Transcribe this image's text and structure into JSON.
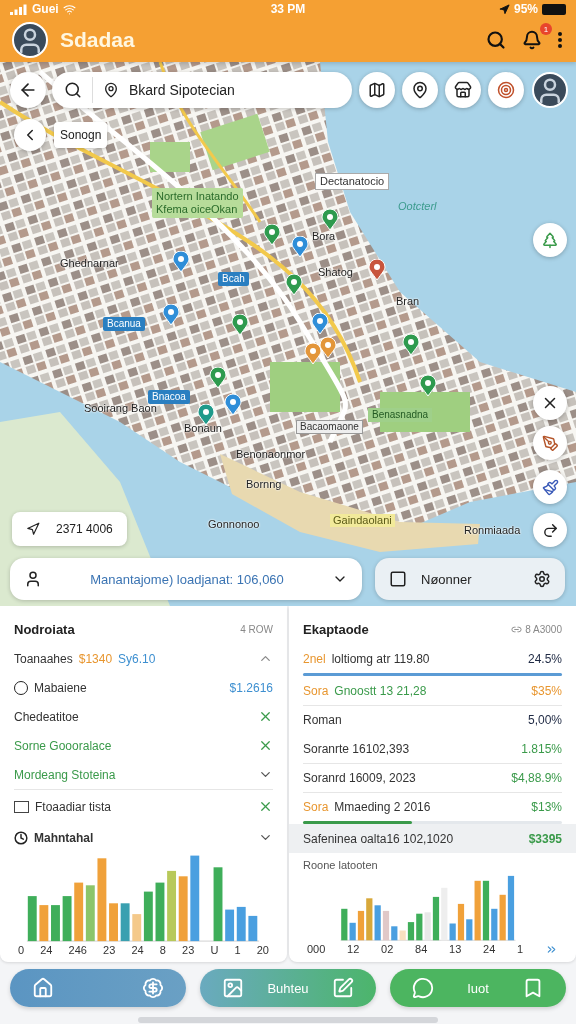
{
  "status_bar": {
    "carrier": "Guei",
    "time": "33 PM",
    "battery": "95%"
  },
  "app_bar": {
    "title": "Sdadaa",
    "notification_badge": "1"
  },
  "search": {
    "value": "Bkard Sipotecian"
  },
  "map": {
    "chip": "Sonogn",
    "date_chip": "2371 4006",
    "labels": [
      {
        "kind": "district",
        "lines": [
          "Nortern Inatando",
          "Kfema oiceOkan"
        ]
      },
      {
        "kind": "callout",
        "lines": [
          "Dectanatocio"
        ]
      },
      {
        "kind": "water",
        "lines": [
          "Ootcterl"
        ]
      },
      {
        "kind": "plain",
        "lines": [
          "Bora"
        ]
      },
      {
        "kind": "plain",
        "lines": [
          "Ghednarnar"
        ]
      },
      {
        "kind": "plain",
        "lines": [
          "Shatog"
        ]
      },
      {
        "kind": "plain",
        "lines": [
          "Bran"
        ]
      },
      {
        "kind": "plain",
        "lines": [
          "Sooirang Baon"
        ]
      },
      {
        "kind": "plain",
        "lines": [
          "Bonaun"
        ]
      },
      {
        "kind": "plain",
        "lines": [
          "Benonaonmor"
        ]
      },
      {
        "kind": "plain",
        "lines": [
          "Bornng"
        ]
      },
      {
        "kind": "plain",
        "lines": [
          "Gonnonoo"
        ]
      },
      {
        "kind": "highlight",
        "lines": [
          "Gaindaolani"
        ]
      },
      {
        "kind": "plain",
        "lines": [
          "Ronmiaada"
        ]
      },
      {
        "kind": "tag",
        "lines": [
          "Bcah"
        ]
      },
      {
        "kind": "tag",
        "lines": [
          "Bcanua"
        ]
      },
      {
        "kind": "tag",
        "lines": [
          "Bnacoa"
        ]
      },
      {
        "kind": "park",
        "lines": [
          "Benasnadna"
        ]
      },
      {
        "kind": "road",
        "lines": [
          "Bacaomaone"
        ]
      }
    ],
    "pins": [
      {
        "color": "#2f8ed8"
      },
      {
        "color": "#2e9a4e"
      },
      {
        "color": "#2f8ed8"
      },
      {
        "color": "#2e9a4e"
      },
      {
        "color": "#2e9a4e"
      },
      {
        "color": "#c8553d"
      },
      {
        "color": "#2f8ed8"
      },
      {
        "color": "#2f8ed8"
      },
      {
        "color": "#e3963a"
      },
      {
        "color": "#e3963a"
      },
      {
        "color": "#2e9a4e"
      },
      {
        "color": "#2e9a4e"
      },
      {
        "color": "#2e9a4e"
      },
      {
        "color": "#2f8ed8"
      },
      {
        "color": "#1f9a8a"
      },
      {
        "color": "#2e9a4e"
      }
    ]
  },
  "route_field": {
    "value": "Manantajome) loadjanat: 106,060"
  },
  "mode_card": {
    "label": "Nøonner"
  },
  "left_panel": {
    "title": "Nodroiata",
    "caption": "4 ROW",
    "rows": [
      {
        "kind": "amounts",
        "label": "Toanaahes",
        "amount_1": "$1340",
        "amount_2": "Sy6.10",
        "expanded": true
      },
      {
        "kind": "radio",
        "label": "Mabaiene",
        "value": "$1.2616",
        "selected": false
      },
      {
        "kind": "removable",
        "label": "Chedeatitoe",
        "accented": false
      },
      {
        "kind": "removable",
        "label": "Sorne Goooralace",
        "accented": true
      },
      {
        "kind": "expandable",
        "label": "Mordeang Stoteina",
        "accented": true,
        "expanded": false
      },
      {
        "kind": "checkbox",
        "label": "Ftoaadiar tista",
        "checked": false
      },
      {
        "kind": "heading",
        "label": "Mahntahal",
        "expanded": false
      }
    ],
    "chart_labels": [
      "0",
      "24",
      "246",
      "23",
      "24",
      "8",
      "23",
      "U",
      "1",
      "20"
    ]
  },
  "right_panel": {
    "title": "Ekaptaode",
    "caption": "8 A3000",
    "rows": [
      {
        "prefix": "2nel",
        "label": "loltiomg atr 119.80",
        "label_accented": false,
        "value": "24.5%",
        "color": "#1f2a44",
        "level": 1,
        "selected": false
      },
      {
        "prefix": "Sora",
        "label": "Gnoostt 13 21,28",
        "label_accented": true,
        "value": "$35%",
        "color": "#e8962f",
        "selected": false
      },
      {
        "label": "Roman",
        "label_accented": false,
        "value": "5,00%",
        "color": "#1f2a44",
        "selected": false
      },
      {
        "label": "Soranrte 16102,393",
        "label_accented": false,
        "value": "1.815%",
        "color": "#3a9a4a",
        "selected": false
      },
      {
        "label": "Soranrd 16009, 2023",
        "label_accented": false,
        "value": "$4,88.9%",
        "color": "#3a9a4a",
        "selected": false
      },
      {
        "prefix": "Sora",
        "label": "Mmaeding 2 2016",
        "label_accented": false,
        "value": "$13%",
        "color": "#3a9a4a",
        "level": 0.42,
        "selected": false
      },
      {
        "label": "Safeninea oalta16 102,1020",
        "label_accented": false,
        "value": "$3395",
        "color": "#3a9a4a",
        "selected": true
      }
    ],
    "chart_title": "Roone latooten",
    "chart_labels": [
      "000",
      "12",
      "02",
      "84",
      "13",
      "24",
      "1"
    ]
  },
  "bottom_nav": [
    {
      "kind": "home"
    },
    {
      "kind": "edit",
      "label": "Buhteu"
    },
    {
      "kind": "chat",
      "label": "Iuot"
    }
  ]
}
